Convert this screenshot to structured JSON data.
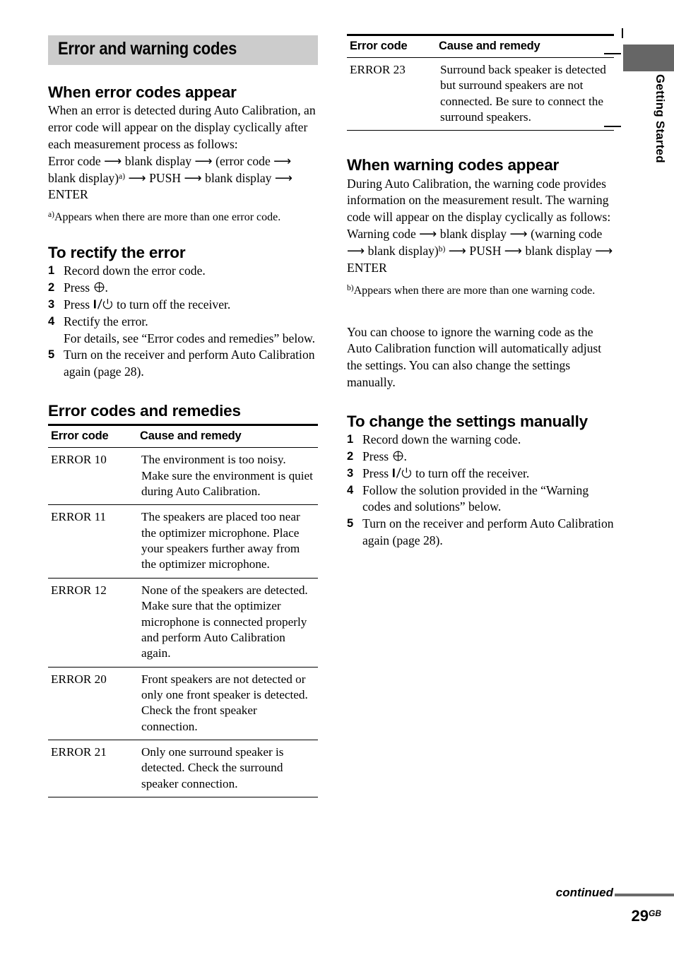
{
  "page": {
    "title_band": "Error and warning codes",
    "side_tab": "Getting Started",
    "continued": "continued",
    "page_number": "29",
    "page_number_sup": "GB",
    "band_color": "#cccccc",
    "side_tab_color": "#666666",
    "rule_color": "#6b6b6b"
  },
  "left": {
    "s1": {
      "heading": "When error codes appear",
      "para": "When an error is detected during Auto Calibration, an error code will appear on the display cyclically after each measurement process as follows:",
      "flow_1": "Error code",
      "flow_2": "blank display",
      "flow_3": "(error code",
      "flow_4": "blank display)",
      "flow_4_sup": "a)",
      "flow_5": "PUSH",
      "flow_6": "blank display",
      "flow_7": "ENTER",
      "footnote_marker": "a)",
      "footnote_text": "Appears when there are more than one error code."
    },
    "s2": {
      "heading": "To rectify the error",
      "steps": [
        {
          "num": "1",
          "text": "Record down the error code."
        },
        {
          "num": "2",
          "pre": "Press ",
          "symbol": "enter-jog-icon",
          "post": "."
        },
        {
          "num": "3",
          "pre": "Press ",
          "symbol": "power-standby-icon",
          "post": " to turn off the receiver."
        },
        {
          "num": "4",
          "text": "Rectify the error.",
          "cont": "For details, see “Error codes and remedies” below."
        },
        {
          "num": "5",
          "text": "Turn on the receiver and perform Auto Calibration again (page 28)."
        }
      ]
    },
    "s3": {
      "heading": "Error codes and remedies",
      "table": {
        "columns": [
          "Error code",
          "Cause and remedy"
        ],
        "rows": [
          {
            "code": "ERROR 10",
            "cause": "The environment is too noisy. Make sure the environment is quiet during Auto Calibration."
          },
          {
            "code": "ERROR 11",
            "cause": "The speakers are placed too near the optimizer microphone. Place your speakers further away from the optimizer microphone."
          },
          {
            "code": "ERROR 12",
            "cause": "None of the speakers are detected. Make sure that the optimizer microphone is connected properly and perform Auto Calibration again."
          },
          {
            "code": "ERROR 20",
            "cause": "Front speakers are not detected or only one front speaker is detected. Check the front speaker connection."
          },
          {
            "code": "ERROR 21",
            "cause": "Only one surround speaker is detected. Check the surround speaker connection."
          }
        ]
      }
    }
  },
  "right": {
    "t1": {
      "columns": [
        "Error code",
        "Cause and remedy"
      ],
      "rows": [
        {
          "code": "ERROR 23",
          "cause": "Surround back speaker is detected but surround speakers are not connected. Be sure to connect the surround speakers."
        }
      ]
    },
    "s1": {
      "heading": "When warning codes appear",
      "para": "During Auto Calibration, the warning code provides information on the measurement result. The warning code will appear on the display cyclically as follows:",
      "flow_1": "Warning code",
      "flow_2": "blank display",
      "flow_3": "(warning code",
      "flow_4": "blank display)",
      "flow_4_sup": "b)",
      "flow_5": "PUSH",
      "flow_6": "blank display",
      "flow_7": "ENTER",
      "footnote_marker": "b)",
      "footnote_text": "Appears when there are more than one warning code.",
      "para2": "You can choose to ignore the warning code as the Auto Calibration function will automatically adjust the settings. You can also change the settings manually."
    },
    "s2": {
      "heading": "To change the settings manually",
      "steps": [
        {
          "num": "1",
          "text": "Record down the warning code."
        },
        {
          "num": "2",
          "pre": "Press ",
          "symbol": "enter-jog-icon",
          "post": "."
        },
        {
          "num": "3",
          "pre": "Press ",
          "symbol": "power-standby-icon",
          "post": " to turn off the receiver."
        },
        {
          "num": "4",
          "text": "Follow the solution provided in the “Warning codes and solutions” below."
        },
        {
          "num": "5",
          "text": "Turn on the receiver and perform Auto Calibration again (page 28)."
        }
      ]
    }
  }
}
